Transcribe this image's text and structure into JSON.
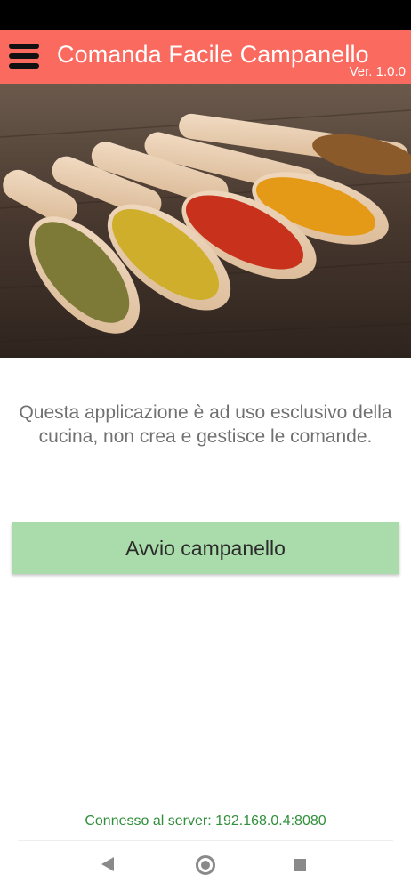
{
  "app_bar": {
    "title": "Comanda Facile Campanello",
    "version": "Ver. 1.0.0",
    "menu_icon": "hamburger-menu-icon",
    "color": "#fa6a5f"
  },
  "hero": {
    "image": "spices-in-wooden-scoops-photo"
  },
  "main": {
    "description": "Questa applicazione è ad uso esclusivo della cucina, non crea e gestisce le comande.",
    "start_button_label": "Avvio campanello",
    "start_button_color": "#a9dcaa"
  },
  "footer": {
    "server_status": "Connesso al server: 192.168.0.4:8080",
    "server_status_color": "#2f8f3a"
  },
  "nav_bar": {
    "icons": [
      "back-icon",
      "home-icon",
      "recents-icon"
    ]
  }
}
